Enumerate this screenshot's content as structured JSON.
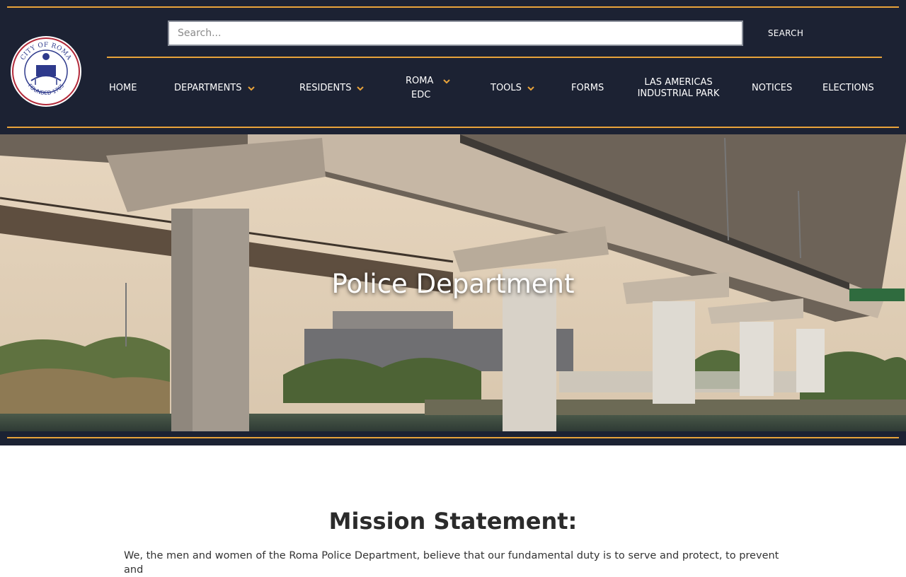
{
  "header": {
    "logo": {
      "arc_top": "CITY OF ROMA",
      "arc_bottom": "FOUNDED 1765",
      "icon": "city-seal-icon"
    },
    "search": {
      "placeholder": "Search...",
      "button_label": "SEARCH"
    },
    "nav": [
      {
        "label": "HOME",
        "has_dropdown": false
      },
      {
        "label": "DEPARTMENTS",
        "has_dropdown": true
      },
      {
        "label": "RESIDENTS",
        "has_dropdown": true
      },
      {
        "label_line1": "ROMA",
        "label_line2": "EDC",
        "has_dropdown": true
      },
      {
        "label": "TOOLS",
        "has_dropdown": true
      },
      {
        "label": "FORMS",
        "has_dropdown": false
      },
      {
        "label_line1": "LAS AMERICAS",
        "label_line2": "INDUSTRIAL PARK",
        "has_dropdown": false
      },
      {
        "label": "NOTICES",
        "has_dropdown": false
      },
      {
        "label": "ELECTIONS",
        "has_dropdown": false
      }
    ]
  },
  "hero": {
    "title": "Police Department"
  },
  "mission": {
    "title": "Mission Statement:",
    "text": "We, the men and women of the Roma Police Department, believe that our fundamental duty is to serve and protect, to prevent and"
  },
  "colors": {
    "header_bg": "#1c2233",
    "accent": "#e8a33a",
    "text_dark": "#2b2b2b"
  }
}
